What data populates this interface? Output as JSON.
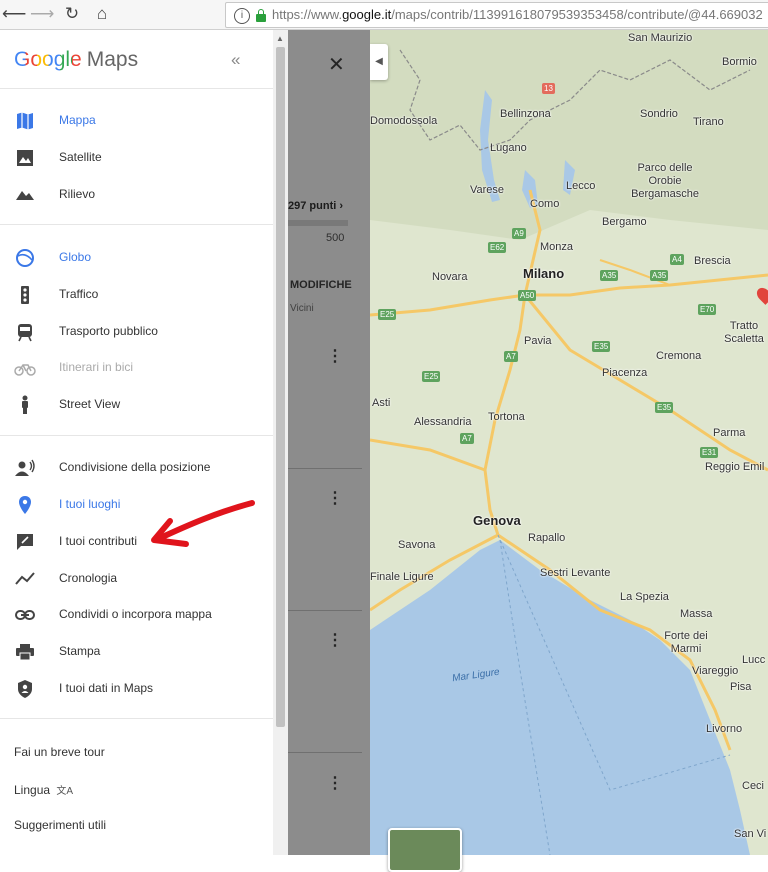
{
  "browser": {
    "url_scheme": "https://www.",
    "url_host": "google.it",
    "url_path": "/maps/contrib/113991618079539353458/contribute/@44.669032"
  },
  "sidebar": {
    "logo_google": "Google",
    "logo_maps": "Maps",
    "collapse_icon": "«",
    "section1": [
      {
        "label": "Mappa",
        "icon": "map-icon",
        "state": "active"
      },
      {
        "label": "Satellite",
        "icon": "satellite-icon",
        "state": "normal"
      },
      {
        "label": "Rilievo",
        "icon": "terrain-icon",
        "state": "normal"
      }
    ],
    "section2": [
      {
        "label": "Globo",
        "icon": "globe-icon",
        "state": "active"
      },
      {
        "label": "Traffico",
        "icon": "traffic-icon",
        "state": "normal"
      },
      {
        "label": "Trasporto pubblico",
        "icon": "transit-icon",
        "state": "normal"
      },
      {
        "label": "Itinerari in bici",
        "icon": "bike-icon",
        "state": "disabled"
      },
      {
        "label": "Street View",
        "icon": "pegman-icon",
        "state": "normal"
      }
    ],
    "section3": [
      {
        "label": "Condivisione della posizione",
        "icon": "location-sharing-icon",
        "state": "normal"
      },
      {
        "label": "I tuoi luoghi",
        "icon": "place-pin-icon",
        "state": "active"
      },
      {
        "label": "I tuoi contributi",
        "icon": "contributions-icon",
        "state": "normal"
      },
      {
        "label": "Cronologia",
        "icon": "timeline-icon",
        "state": "normal"
      },
      {
        "label": "Condividi o incorpora mappa",
        "icon": "link-icon",
        "state": "normal"
      },
      {
        "label": "Stampa",
        "icon": "print-icon",
        "state": "normal"
      },
      {
        "label": "I tuoi dati in Maps",
        "icon": "shield-icon",
        "state": "normal"
      }
    ],
    "footer": {
      "tour": "Fai un breve tour",
      "language": "Lingua",
      "language_icon": "文A",
      "tips": "Suggerimenti utili"
    }
  },
  "underlying_panel": {
    "close": "✕",
    "points": "297 punti ›",
    "goal": "500",
    "tab": "MODIFICHE",
    "nearby": "Vicini",
    "more_icon": "⋮"
  },
  "map": {
    "toggle_icon": "◀",
    "cities": [
      {
        "name": "Milano",
        "size": "big"
      },
      {
        "name": "Genova",
        "size": "big"
      },
      {
        "name": "San Maurizio",
        "size": "small"
      },
      {
        "name": "Bormio",
        "size": "small"
      },
      {
        "name": "Domodossola",
        "size": "small"
      },
      {
        "name": "Bellinzona",
        "size": "small"
      },
      {
        "name": "Sondrio",
        "size": "small"
      },
      {
        "name": "Tirano",
        "size": "small"
      },
      {
        "name": "Lugano",
        "size": "small"
      },
      {
        "name": "Parco delle Orobie Bergamasche",
        "size": "small"
      },
      {
        "name": "Varese",
        "size": "small"
      },
      {
        "name": "Lecco",
        "size": "small"
      },
      {
        "name": "Como",
        "size": "small"
      },
      {
        "name": "Bergamo",
        "size": "small"
      },
      {
        "name": "Monza",
        "size": "small"
      },
      {
        "name": "Brescia",
        "size": "small"
      },
      {
        "name": "Novara",
        "size": "small"
      },
      {
        "name": "Tratto Scaletta",
        "size": "small"
      },
      {
        "name": "Pavia",
        "size": "small"
      },
      {
        "name": "Cremona",
        "size": "small"
      },
      {
        "name": "Piacenza",
        "size": "small"
      },
      {
        "name": "Asti",
        "size": "small"
      },
      {
        "name": "Tortona",
        "size": "small"
      },
      {
        "name": "Alessandria",
        "size": "small"
      },
      {
        "name": "Parma",
        "size": "small"
      },
      {
        "name": "Reggio Emil",
        "size": "small"
      },
      {
        "name": "Savona",
        "size": "small"
      },
      {
        "name": "Rapallo",
        "size": "small"
      },
      {
        "name": "Finale Ligure",
        "size": "small"
      },
      {
        "name": "Sestri Levante",
        "size": "small"
      },
      {
        "name": "La Spezia",
        "size": "small"
      },
      {
        "name": "Massa",
        "size": "small"
      },
      {
        "name": "Forte dei Marmi",
        "size": "small"
      },
      {
        "name": "Viareggio",
        "size": "small"
      },
      {
        "name": "Lucc",
        "size": "small"
      },
      {
        "name": "Pisa",
        "size": "small"
      },
      {
        "name": "Livorno",
        "size": "small"
      },
      {
        "name": "Ceci",
        "size": "small"
      },
      {
        "name": "San Vi",
        "size": "small"
      },
      {
        "name": "Mar Ligure",
        "size": "sea"
      }
    ],
    "roads": [
      "13",
      "E62",
      "A9",
      "A4",
      "E25",
      "A50",
      "A35",
      "A35",
      "E70",
      "A7",
      "E35",
      "E25",
      "E35",
      "A7",
      "E31"
    ]
  },
  "colors": {
    "accent": "#3b78e7",
    "water": "#a9c8e6",
    "land": "#dfe6cf",
    "highway": "#f5c867",
    "annotation_arrow": "#e0141c"
  }
}
